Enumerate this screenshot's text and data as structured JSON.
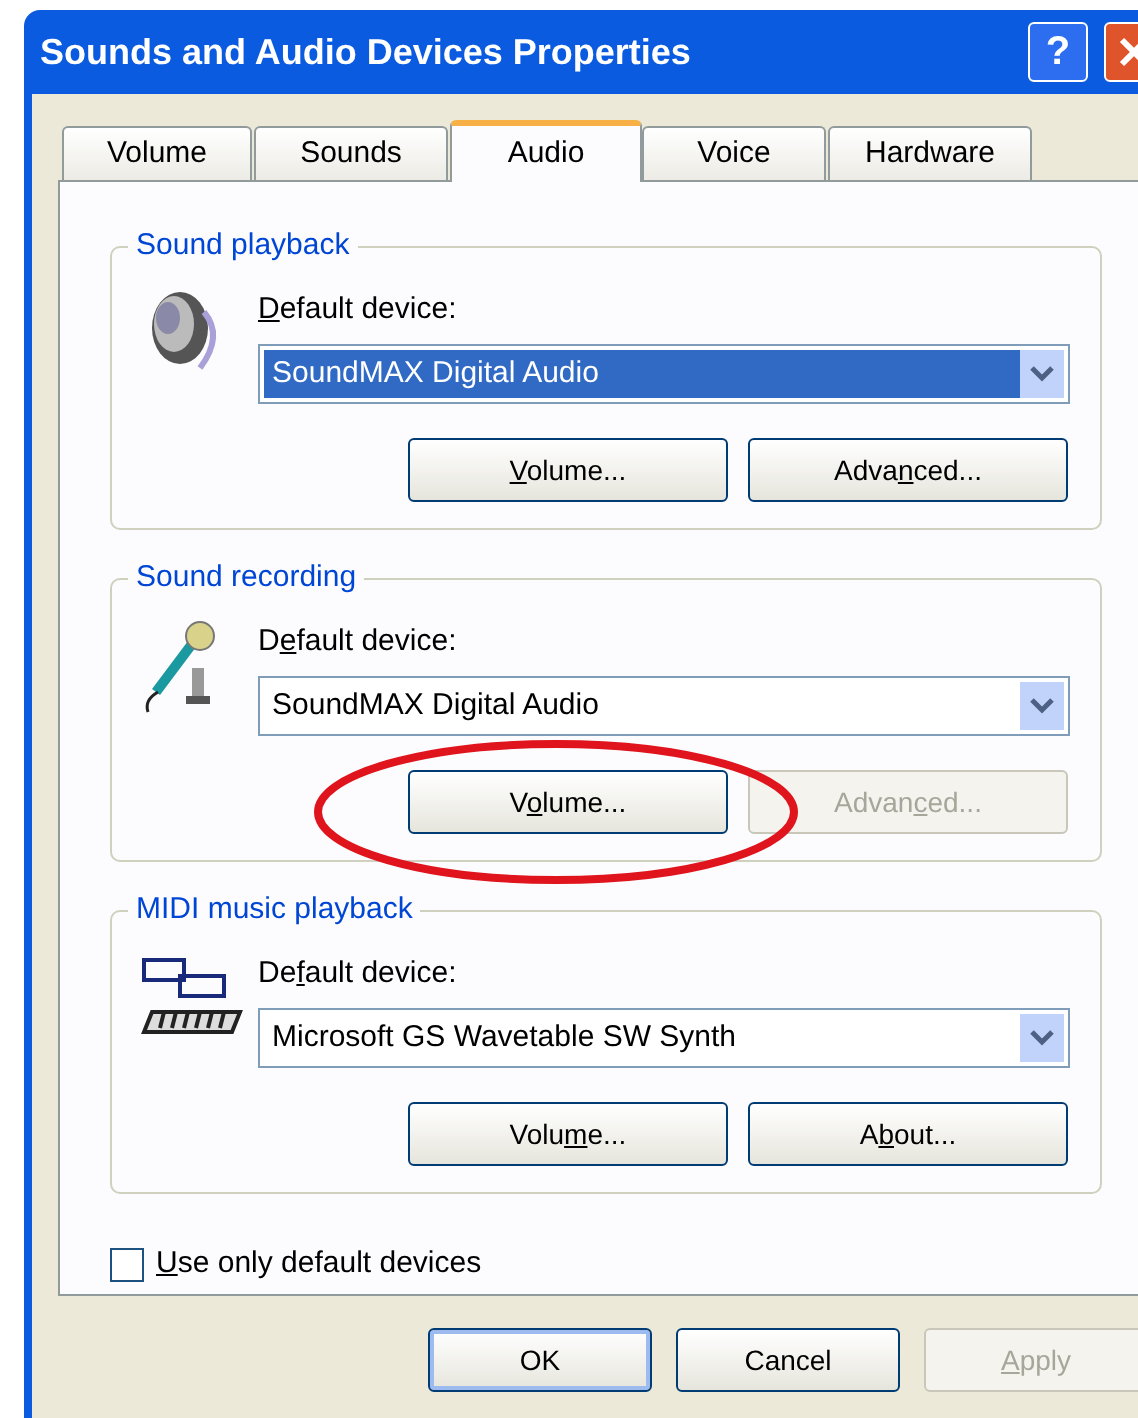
{
  "window": {
    "title": "Sounds and Audio Devices Properties",
    "title_buttons": [
      {
        "kind": "help",
        "label": "?"
      },
      {
        "kind": "close"
      }
    ]
  },
  "tabs": [
    {
      "label": "Volume",
      "selected": false
    },
    {
      "label": "Sounds",
      "selected": false
    },
    {
      "label": "Audio",
      "selected": true
    },
    {
      "label": "Voice",
      "selected": false
    },
    {
      "label": "Hardware",
      "selected": false
    }
  ],
  "groups": [
    {
      "kind": "speaker",
      "title": "Sound playback",
      "device_label": {
        "key": "D",
        "post": "efault device:"
      },
      "device": "SoundMAX Digital Audio",
      "device_selected": true,
      "buttons": [
        {
          "label": {
            "key": "V",
            "post": "olume..."
          },
          "disabled": false
        },
        {
          "label": {
            "pre": "Adva",
            "key": "n",
            "post": "ced..."
          },
          "disabled": false
        }
      ]
    },
    {
      "kind": "microphone",
      "title": "Sound recording",
      "device_label": {
        "pre": "D",
        "key": "e",
        "post": "fault device:"
      },
      "device": "SoundMAX Digital Audio",
      "device_selected": false,
      "buttons": [
        {
          "label": {
            "pre": "V",
            "key": "o",
            "post": "lume..."
          },
          "disabled": false
        },
        {
          "label": {
            "pre": "Advan",
            "key": "c",
            "post": "ed..."
          },
          "disabled": true
        }
      ]
    },
    {
      "kind": "midi",
      "title": "MIDI music playback",
      "device_label": {
        "pre": "De",
        "key": "f",
        "post": "ault device:"
      },
      "device": "Microsoft GS Wavetable SW Synth",
      "device_selected": false,
      "buttons": [
        {
          "label": {
            "pre": "Volu",
            "key": "m",
            "post": "e..."
          },
          "disabled": false
        },
        {
          "label": {
            "pre": "A",
            "key": "b",
            "post": "out..."
          },
          "disabled": false
        }
      ]
    }
  ],
  "default_only": {
    "label": {
      "key": "U",
      "post": "se only default devices"
    },
    "checked": false
  },
  "dialog_buttons": [
    {
      "label": {
        "pre": "OK"
      },
      "disabled": false,
      "default": true
    },
    {
      "label": {
        "pre": "Cancel"
      },
      "disabled": false,
      "default": false
    },
    {
      "label": {
        "key": "A",
        "post": "pply"
      },
      "disabled": true,
      "default": false
    }
  ],
  "annotation": {
    "kind": "ellipse",
    "color": "#e0141c"
  }
}
